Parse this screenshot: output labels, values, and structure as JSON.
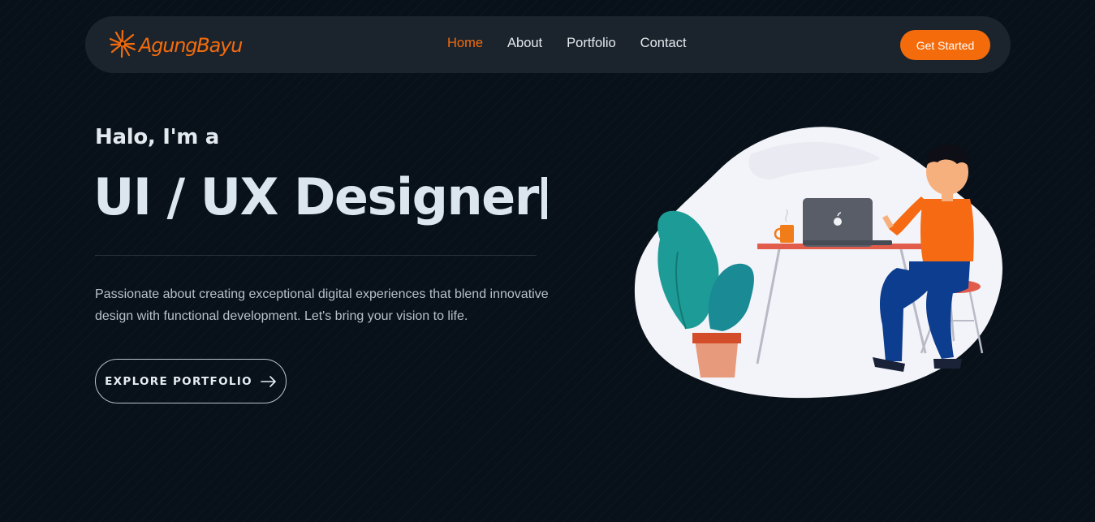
{
  "brand": {
    "name": "AgungBayu",
    "logo_icon": "starburst-logo-icon",
    "accent": "#f46b0c"
  },
  "nav": {
    "links": [
      {
        "label": "Home",
        "active": true
      },
      {
        "label": "About",
        "active": false
      },
      {
        "label": "Portfolio",
        "active": false
      },
      {
        "label": "Contact",
        "active": false
      }
    ],
    "cta_label": "Get Started"
  },
  "hero": {
    "greeting": "Halo, I'm a",
    "role": "UI / UX Designer",
    "description": "Passionate about creating exceptional digital experiences that blend innovative design with functional development. Let's bring your vision to life.",
    "button_label": "EXPLORE PORTFOLIO",
    "button_icon": "arrow-right-icon"
  },
  "illustration": {
    "subject": "designer-at-desk-illustration"
  },
  "colors": {
    "background": "#081119",
    "navbar": "#1b242d",
    "accent": "#f46b0c",
    "text": "#dce6ef"
  }
}
